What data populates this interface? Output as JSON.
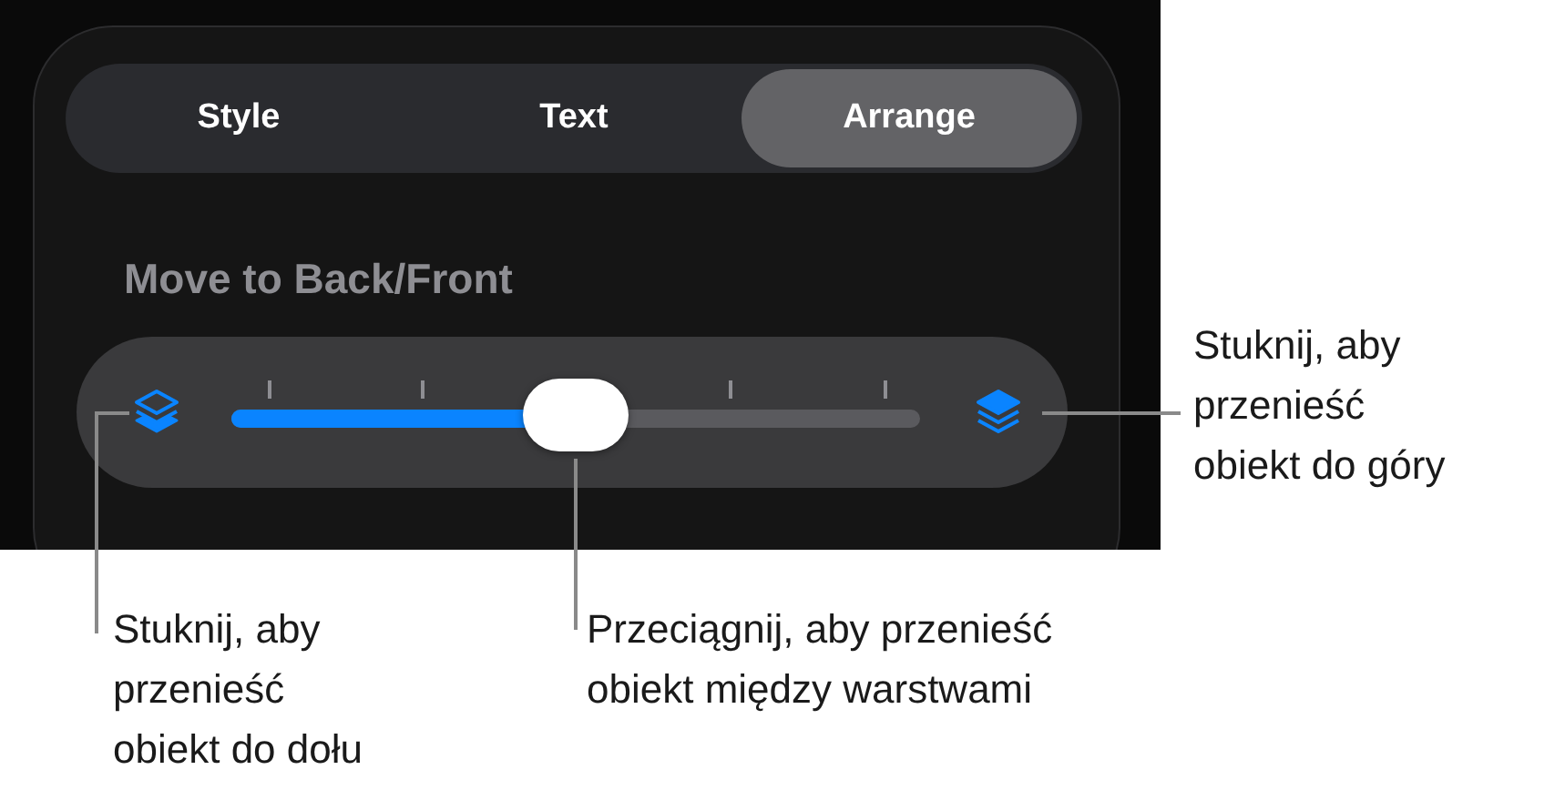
{
  "tabs": [
    {
      "label": "Style",
      "selected": false
    },
    {
      "label": "Text",
      "selected": false
    },
    {
      "label": "Arrange",
      "selected": true
    }
  ],
  "section": {
    "heading": "Move to Back/Front"
  },
  "slider": {
    "level": 0.5
  },
  "callouts": [
    {
      "kind": "right",
      "text": "Stuknij, aby\nprzenieść\nobiekt do góry"
    },
    {
      "kind": "left",
      "text": "Stuknij, aby\nprzenieść\nobiekt do dołu"
    },
    {
      "kind": "middle",
      "text": "Przeciągnij, aby przenieść\nobiekt między warstwami"
    }
  ]
}
